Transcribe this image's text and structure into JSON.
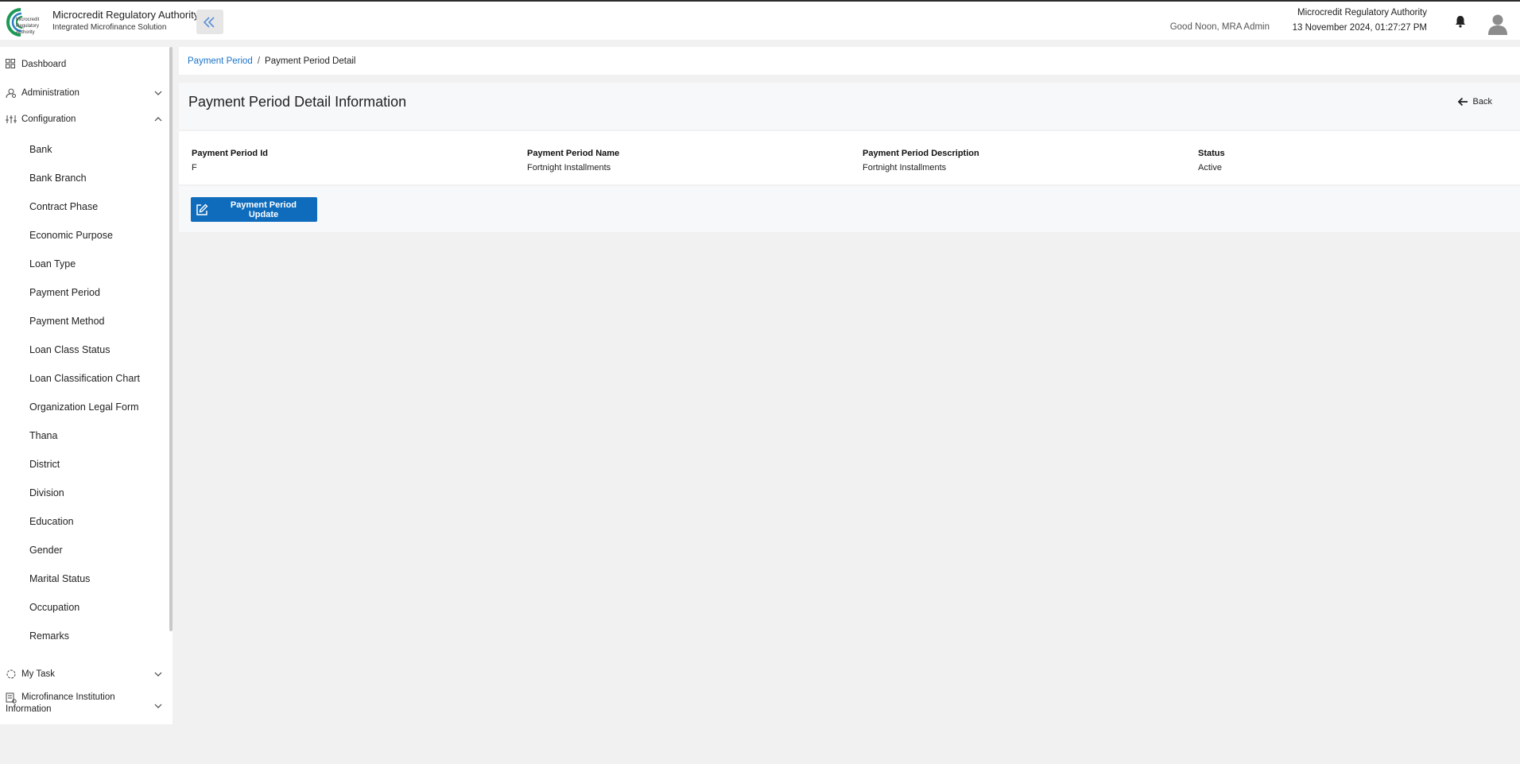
{
  "header": {
    "org_name": "Microcredit Regulatory Authority",
    "org_subtitle": "Integrated Microfinance Solution",
    "greeting": "Good Noon, MRA Admin",
    "org_right": "Microcredit Regulatory Authority",
    "datetime": "13 November 2024, 01:27:27 PM"
  },
  "sidebar": {
    "dashboard": "Dashboard",
    "administration": "Administration",
    "configuration": "Configuration",
    "config_items": [
      "Bank",
      "Bank Branch",
      "Contract Phase",
      "Economic Purpose",
      "Loan Type",
      "Payment Period",
      "Payment Method",
      "Loan Class Status",
      "Loan Classification Chart",
      "Organization Legal Form",
      "Thana",
      "District",
      "Division",
      "Education",
      "Gender",
      "Marital Status",
      "Occupation",
      "Remarks"
    ],
    "my_task": "My Task",
    "mfi_info": "Microfinance Institution Information"
  },
  "breadcrumb": {
    "parent": "Payment Period",
    "separator": "/",
    "current": "Payment Period Detail"
  },
  "detail": {
    "title": "Payment Period Detail Information",
    "back_label": "Back",
    "fields": [
      {
        "label": "Payment Period Id",
        "value": "F"
      },
      {
        "label": "Payment Period Name",
        "value": "Fortnight Installments"
      },
      {
        "label": "Payment Period Description",
        "value": "Fortnight Installments"
      },
      {
        "label": "Status",
        "value": "Active"
      }
    ],
    "update_button": "Payment Period Update"
  },
  "colors": {
    "primary": "#0f6cbd",
    "link": "#1a73c9",
    "logo_green": "#1a9a55"
  }
}
